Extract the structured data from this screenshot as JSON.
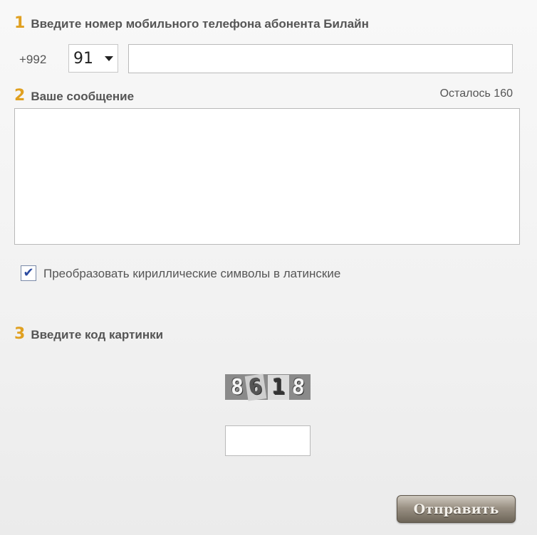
{
  "step1": {
    "number": "1",
    "title": "Введите номер мобильного телефона абонента Билайн"
  },
  "phone": {
    "prefix": "+992",
    "operator_code": "91",
    "number_value": ""
  },
  "step2": {
    "number": "2",
    "title": "Ваше сообщение",
    "remaining": "Осталось 160"
  },
  "message": {
    "value": ""
  },
  "transliterate": {
    "checked": true,
    "label": "Преобразовать кириллические символы в латинские"
  },
  "step3": {
    "number": "3",
    "title": "Введите код картинки"
  },
  "captcha": {
    "digits": [
      "8",
      "6",
      "1",
      "8"
    ]
  },
  "code": {
    "value": ""
  },
  "submit": {
    "label": "Отправить"
  }
}
